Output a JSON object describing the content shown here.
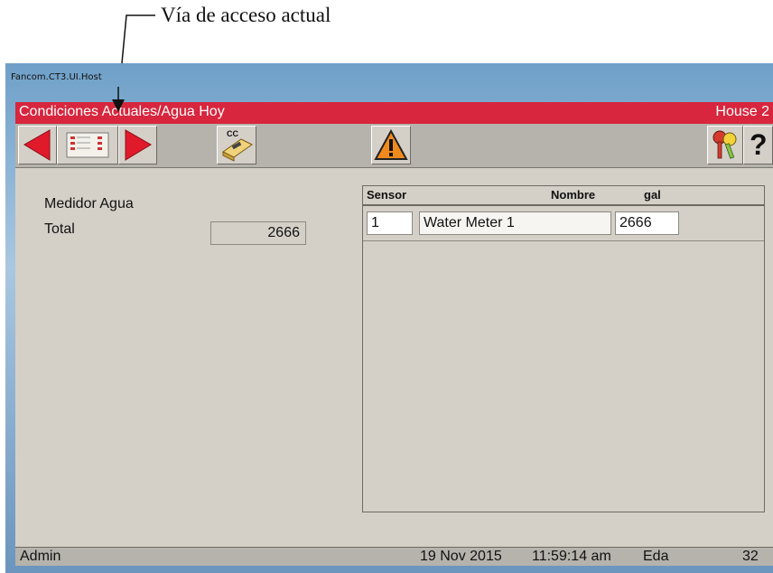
{
  "annotation": {
    "label": "Vía de acceso actual"
  },
  "window": {
    "title": "Fancom.CT3.UI.Host"
  },
  "header": {
    "path": "Condiciones Actuales/Agua Hoy",
    "house": "House 2"
  },
  "toolbar": {
    "buttons": [
      {
        "icon": "arrow-left-icon"
      },
      {
        "icon": "list-icon"
      },
      {
        "icon": "arrow-right-icon"
      },
      {
        "icon": "cc-tool-icon",
        "label": "CC"
      },
      {
        "icon": "warning-icon"
      },
      {
        "icon": "keys-icon"
      },
      {
        "icon": "help-icon",
        "label": "?"
      }
    ]
  },
  "left_panel": {
    "section": "Medidor Agua",
    "total_label": "Total",
    "total_value": "2666"
  },
  "grid": {
    "columns": [
      "Sensor",
      "Nombre",
      "gal"
    ],
    "rows": [
      {
        "sensor": "1",
        "name": "Water Meter 1",
        "gal": "2666"
      }
    ]
  },
  "status": {
    "user": "Admin",
    "date": "19 Nov 2015",
    "time": "11:59:14 am",
    "extra": "Eda",
    "number": "32"
  },
  "colors": {
    "header_red": "#d7263d",
    "arrow_red": "#e01a2b",
    "warning_orange": "#f08a1c"
  }
}
